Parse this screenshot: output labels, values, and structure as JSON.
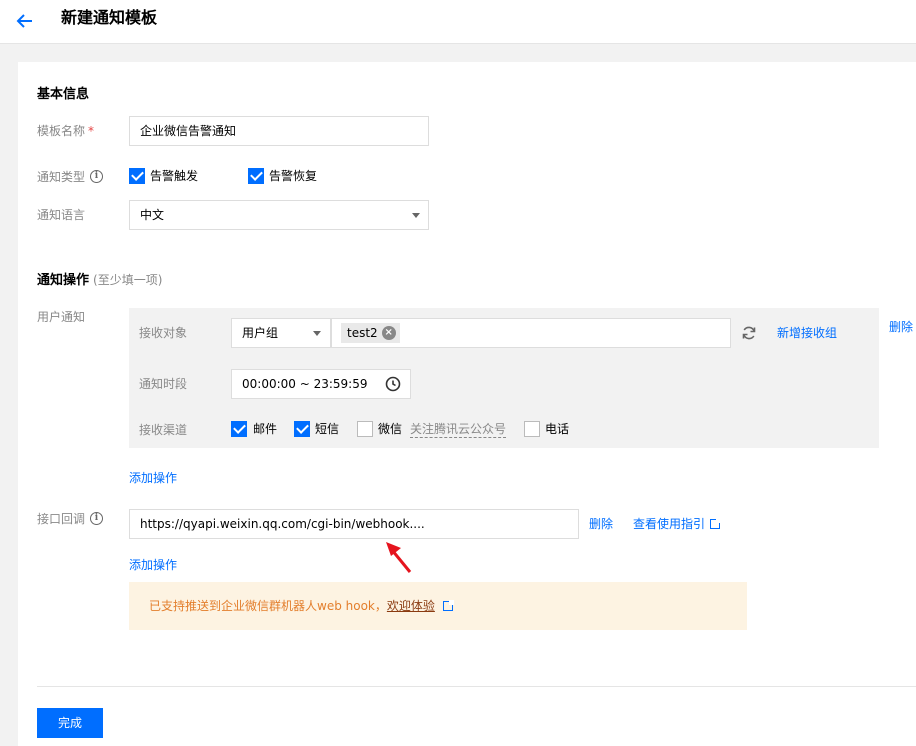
{
  "header": {
    "title": "新建通知模板"
  },
  "basic": {
    "section_title": "基本信息",
    "name_label": "模板名称",
    "name_value": "企业微信告警通知",
    "type_label": "通知类型",
    "type_trigger": "告警触发",
    "type_recover": "告警恢复",
    "lang_label": "通知语言",
    "lang_value": "中文"
  },
  "actions": {
    "section_title": "通知操作",
    "section_sub": "(至少填一项)",
    "user_notify_label": "用户通知",
    "recipient_label": "接收对象",
    "recipient_type": "用户组",
    "recipient_tag": "test2",
    "add_group": "新增接收组",
    "delete": "删除",
    "period_label": "通知时段",
    "period_value": "00:00:00 ~ 23:59:59",
    "channel_label": "接收渠道",
    "ch_email": "邮件",
    "ch_sms": "短信",
    "ch_wechat": "微信",
    "ch_wechat_hint": "关注腾讯云公众号",
    "ch_phone": "电话",
    "add_action_1": "添加操作",
    "callback_label": "接口回调",
    "callback_value": "https://qyapi.weixin.qq.com/cgi-bin/webhook....",
    "callback_delete": "删除",
    "callback_guide": "查看使用指引",
    "add_action_2": "添加操作",
    "notice_text": "已支持推送到企业微信群机器人web hook，",
    "notice_link": "欢迎体验"
  },
  "footer": {
    "submit": "完成"
  },
  "colors": {
    "primary": "#006eff",
    "notice_bg": "#fdf3e2",
    "notice_text": "#e37e2c",
    "arrow": "#e5141e"
  }
}
